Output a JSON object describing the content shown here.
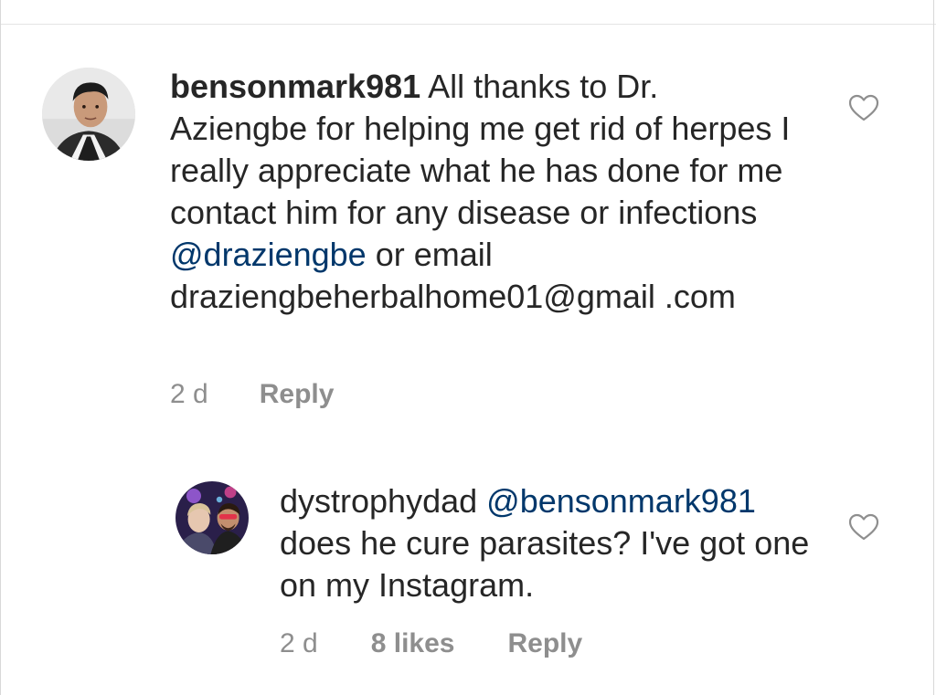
{
  "comment": {
    "username": "bensonmark981",
    "text_1": " All thanks to Dr. Aziengbe  for helping me get rid of herpes I really appreciate what he has done for me contact him for any disease or infections ",
    "mention": "@draziengbe",
    "text_2": " or email draziengbeherbalhome01@gmail .com",
    "time": "2 d",
    "reply_label": "Reply",
    "avatar_icon": "profile-photo"
  },
  "reply": {
    "username": "dystrophydad",
    "mention": "@bensonmark981",
    "text": " does he cure parasites? I've got one on my Instagram.",
    "time": "2 d",
    "likes_label": "8 likes",
    "reply_label": "Reply",
    "avatar_icon": "profile-photo"
  },
  "icons": {
    "like": "heart-outline-icon"
  },
  "colors": {
    "text": "#262626",
    "secondary": "#8e8e8e",
    "mention": "#00376b",
    "background": "#ffffff"
  }
}
